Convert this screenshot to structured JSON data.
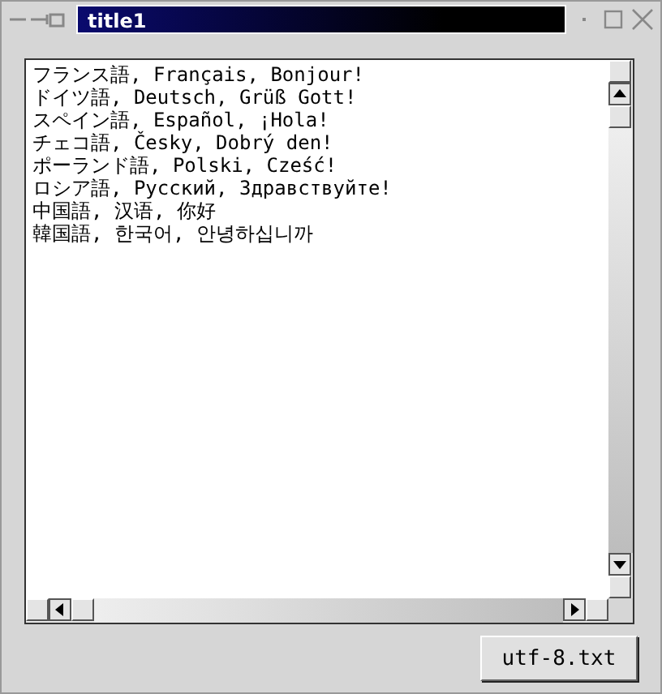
{
  "window": {
    "title": "title1"
  },
  "text_lines": [
    "フランス語, Français, Bonjour!",
    "ドイツ語, Deutsch, Grüß Gott!",
    "スペイン語, Español, ¡Hola!",
    "チェコ語, Česky, Dobrý den!",
    "ポーランド語, Polski, Cześć!",
    "ロシア語, Русский, Здравствуйте!",
    "中国語, 汉语, 你好",
    "韓国語, 한국어, 안녕하십니까"
  ],
  "button": {
    "label": "utf-8.txt"
  }
}
